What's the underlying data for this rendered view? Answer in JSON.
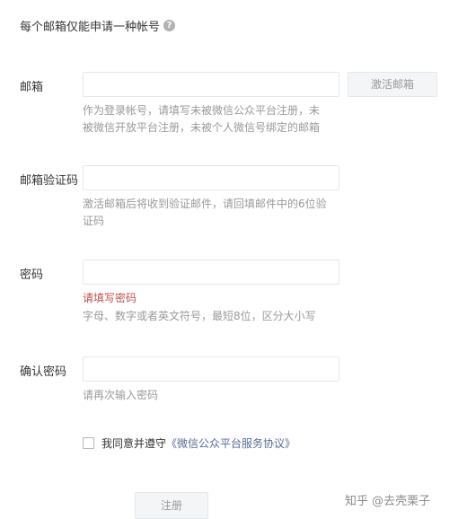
{
  "notice": {
    "text": "每个邮箱仅能申请一种帐号",
    "help_icon": "question-circle-icon",
    "help_glyph": "?"
  },
  "email": {
    "label": "邮箱",
    "value": "",
    "activate_button": "激活邮箱",
    "hint": "作为登录帐号，请填写未被微信公众平台注册，未被微信开放平台注册，未被个人微信号绑定的邮箱"
  },
  "code": {
    "label": "邮箱验证码",
    "value": "",
    "hint": "激活邮箱后将收到验证邮件，请回填邮件中的6位验证码"
  },
  "password": {
    "label": "密码",
    "value": "",
    "error": "请填写密码",
    "hint": "字母、数字或者英文符号，最短8位，区分大小写"
  },
  "confirm": {
    "label": "确认密码",
    "value": "",
    "hint": "请再次输入密码"
  },
  "agreement": {
    "prefix": "我同意并遵守",
    "link": "《微信公众平台服务协议》",
    "checked": false
  },
  "register_button": "注册",
  "watermark": "知乎 @去壳栗子",
  "colors": {
    "link": "#576b95",
    "error": "#c0504d",
    "hint": "#9a9a9a"
  }
}
